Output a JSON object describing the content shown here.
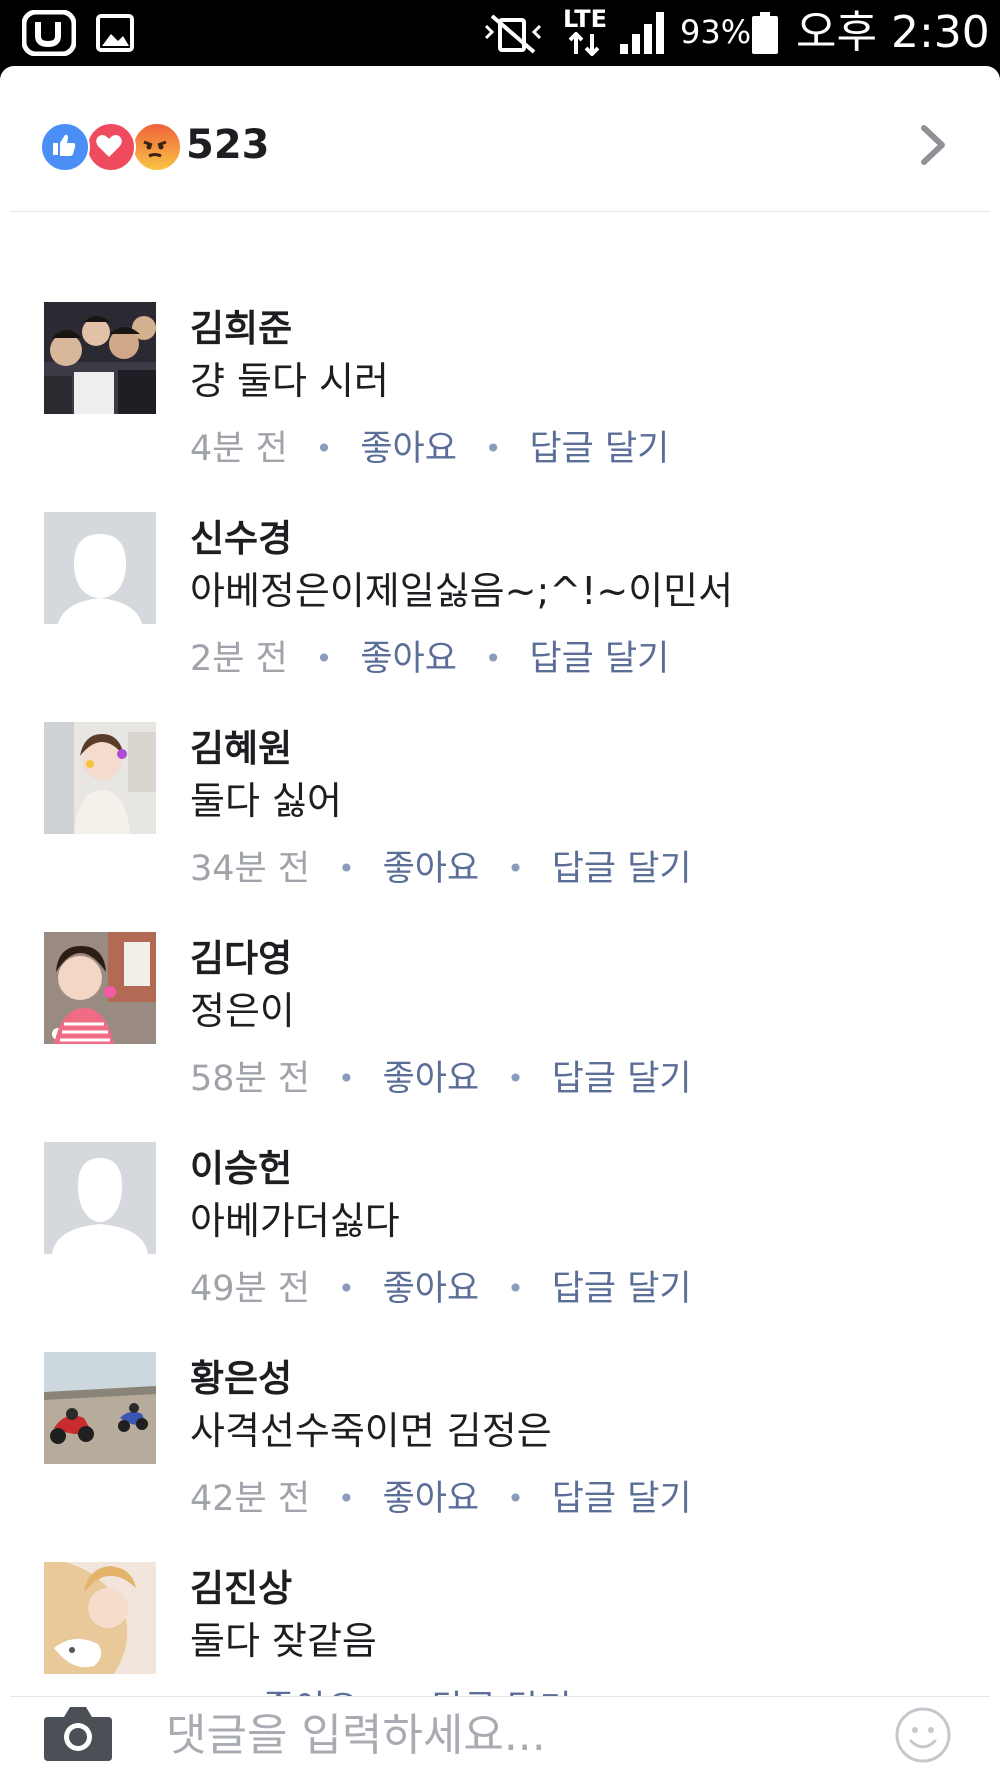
{
  "status_bar": {
    "battery_percent": "93%",
    "network": "LTE",
    "time": "오후 2:30",
    "icons": [
      "u-plus-logo-icon",
      "gallery-icon",
      "vibrate-mute-icon",
      "lte-data-icon",
      "signal-icon",
      "battery-icon"
    ]
  },
  "reactions": {
    "count": "523",
    "icons": [
      "like-icon",
      "love-icon",
      "angry-icon"
    ],
    "colors": {
      "like": "#4b8ff6",
      "love": "#ef4b5f",
      "angry": "#f0613a"
    }
  },
  "comments": [
    {
      "name": "김희준",
      "text": "걍 둘다 시러",
      "time": "4분 전",
      "like": "좋아요",
      "reply": "답글 달기",
      "avatar": "photo-group"
    },
    {
      "name": "신수경",
      "text": "아베정은이제일싫음~;^!~이민서",
      "time": "2분 전",
      "like": "좋아요",
      "reply": "답글 달기",
      "avatar": "default-female"
    },
    {
      "name": "김혜원",
      "text": "둘다 싫어",
      "time": "34분 전",
      "like": "좋아요",
      "reply": "답글 달기",
      "avatar": "photo-selfie"
    },
    {
      "name": "김다영",
      "text": "정은이",
      "time": "58분 전",
      "like": "좋아요",
      "reply": "답글 달기",
      "avatar": "photo-selfie-2"
    },
    {
      "name": "이승헌",
      "text": "아베가더싫다",
      "time": "49분 전",
      "like": "좋아요",
      "reply": "답글 달기",
      "avatar": "default-male"
    },
    {
      "name": "황은성",
      "text": "사격선수죽이면 김정은",
      "time": "42분 전",
      "like": "좋아요",
      "reply": "답글 달기",
      "avatar": "photo-motorcycles"
    },
    {
      "name": "김진상",
      "text": "둘다 잦같음",
      "time": "",
      "like": "좋아요",
      "reply": "답글 달기",
      "avatar": "photo-portrait"
    }
  ],
  "composer": {
    "placeholder": "댓글을 입력하세요...",
    "icons": [
      "camera-icon",
      "emoji-icon"
    ]
  },
  "colors": {
    "name_text": "#1c1e21",
    "link_blue": "#5b6e98",
    "timestamp_gray": "#a0a4aa"
  }
}
